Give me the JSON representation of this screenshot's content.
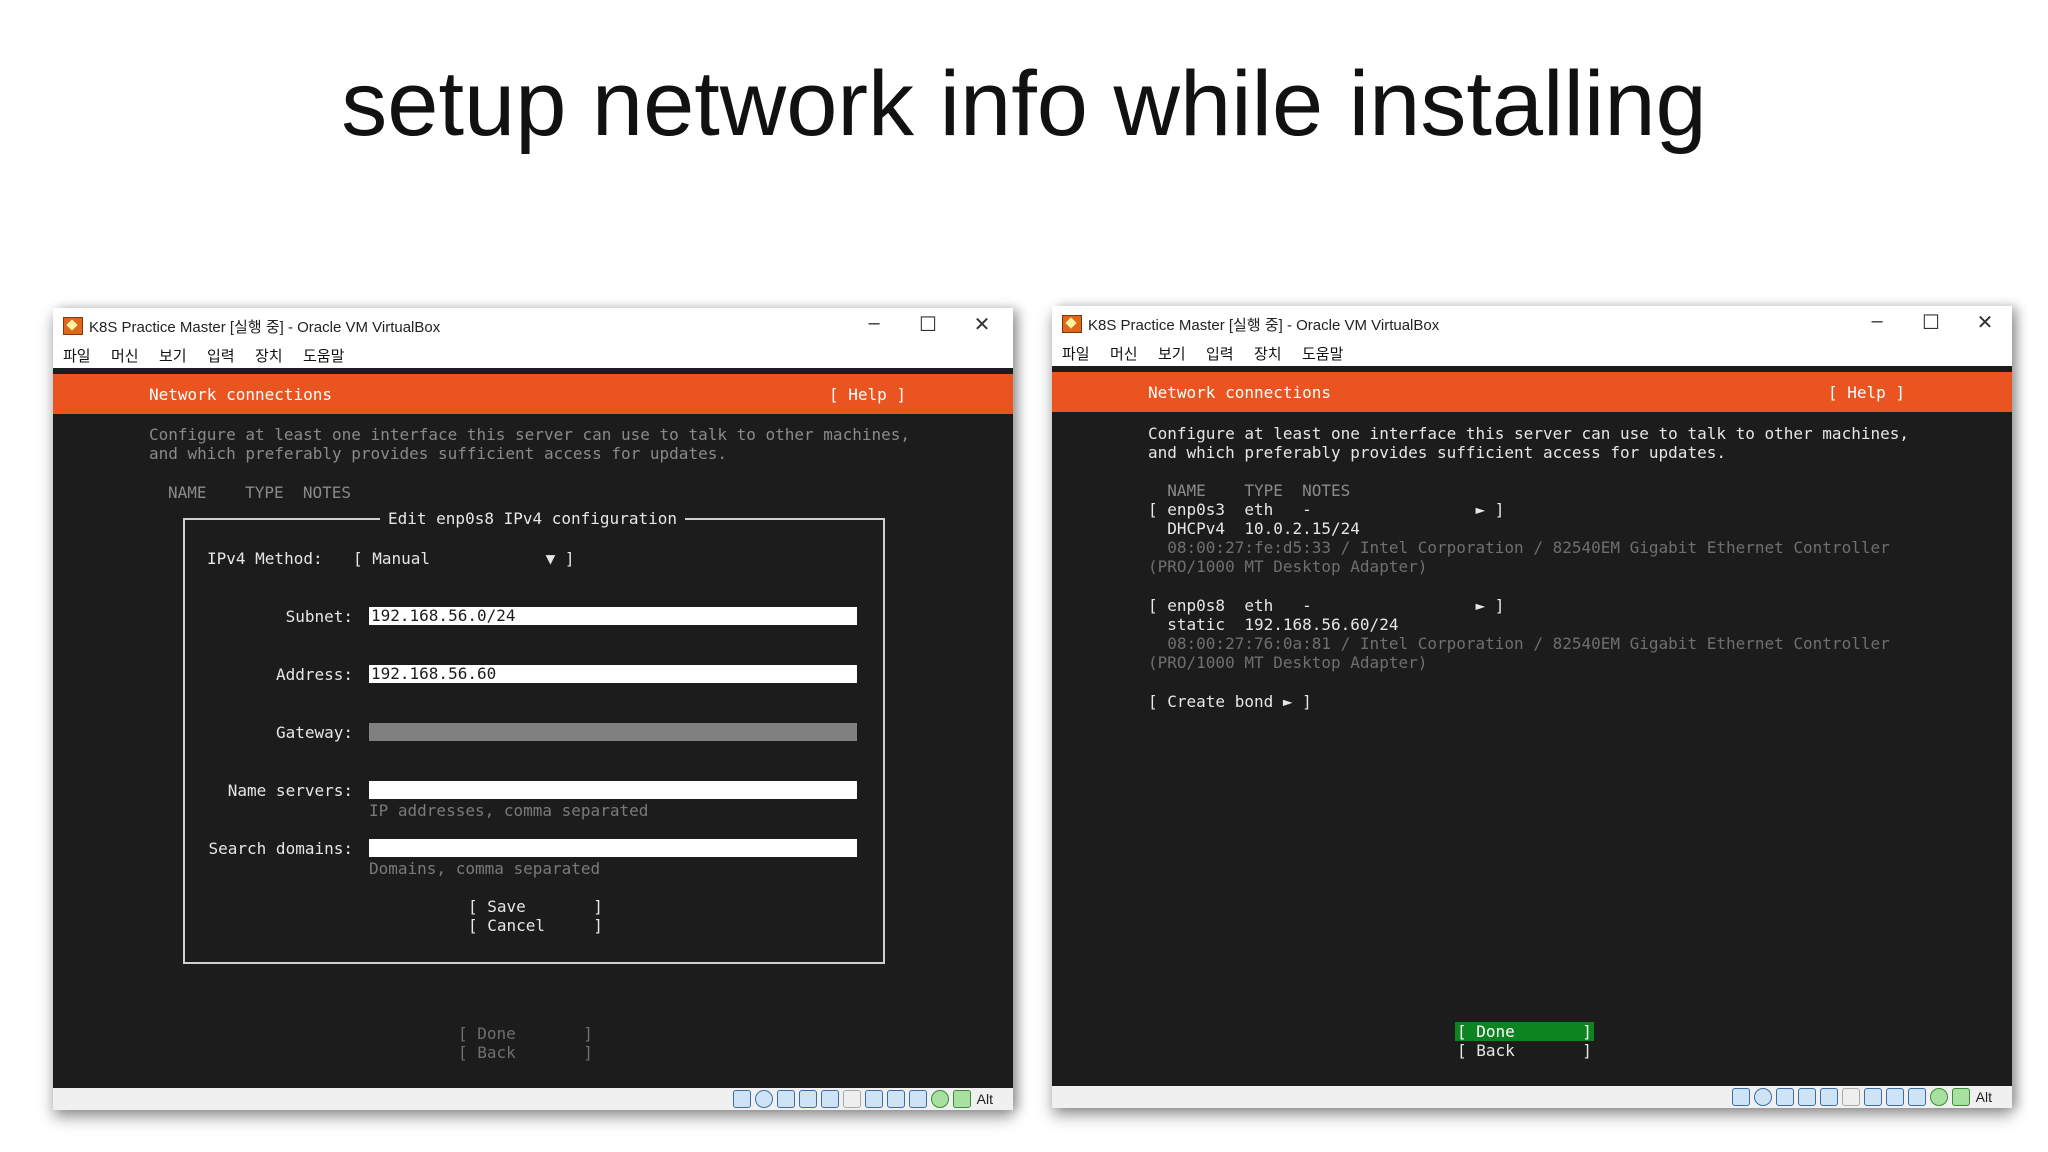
{
  "slide_title": "setup network info while installing",
  "left_window": {
    "title": "K8S Practice Master [실행 중] - Oracle VM VirtualBox",
    "controls": {
      "minimize": "–",
      "maximize": "☐",
      "close": "✕"
    },
    "menu": [
      "파일",
      "머신",
      "보기",
      "입력",
      "장치",
      "도움말"
    ],
    "header": {
      "title": "Network connections",
      "help": "[ Help ]"
    },
    "intro": [
      "Configure at least one interface this server can use to talk to other machines,",
      "and which preferably provides sufficient access for updates."
    ],
    "columns": "NAME    TYPE  NOTES",
    "dialog": {
      "title": "Edit enp0s8 IPv4 configuration",
      "method_label": "IPv4 Method:",
      "method_value": "[ Manual            ▼ ]",
      "subnet_label": "Subnet:",
      "subnet_value": "192.168.56.0/24",
      "address_label": "Address:",
      "address_value": "192.168.56.60",
      "gateway_label": "Gateway:",
      "gateway_value": "",
      "nameservers_label": "Name servers:",
      "nameservers_value": "",
      "nameservers_hint": "IP addresses, comma separated",
      "searchdomains_label": "Search domains:",
      "searchdomains_value": "",
      "searchdomains_hint": "Domains, comma separated",
      "save": "[ Save       ]",
      "cancel": "[ Cancel     ]"
    },
    "done": "[ Done       ]",
    "back": "[ Back       ]",
    "status_alt": "Alt"
  },
  "right_window": {
    "title": "K8S Practice Master [실행 중] - Oracle VM VirtualBox",
    "controls": {
      "minimize": "–",
      "maximize": "☐",
      "close": "✕"
    },
    "menu": [
      "파일",
      "머신",
      "보기",
      "입력",
      "장치",
      "도움말"
    ],
    "header": {
      "title": "Network connections",
      "help": "[ Help ]"
    },
    "intro": [
      "Configure at least one interface this server can use to talk to other machines,",
      "and which preferably provides sufficient access for updates."
    ],
    "columns": "  NAME    TYPE  NOTES",
    "iface1": {
      "row": "[ enp0s3  eth   -                 ► ]",
      "addr": "  DHCPv4  10.0.2.15/24",
      "hw1": "  08:00:27:fe:d5:33 / Intel Corporation / 82540EM Gigabit Ethernet Controller",
      "hw2": "(PRO/1000 MT Desktop Adapter)"
    },
    "iface2": {
      "row": "[ enp0s8  eth   -                 ► ]",
      "addr": "  static  192.168.56.60/24",
      "hw1": "  08:00:27:76:0a:81 / Intel Corporation / 82540EM Gigabit Ethernet Controller",
      "hw2": "(PRO/1000 MT Desktop Adapter)"
    },
    "create_bond": "[ Create bond ► ]",
    "done": "[ Done       ]",
    "back": "[ Back       ]",
    "status_alt": "Alt"
  },
  "colors": {
    "ubuntu_orange": "#e95420",
    "terminal_bg": "#1c1c1c",
    "selected_green": "#0e8420"
  }
}
